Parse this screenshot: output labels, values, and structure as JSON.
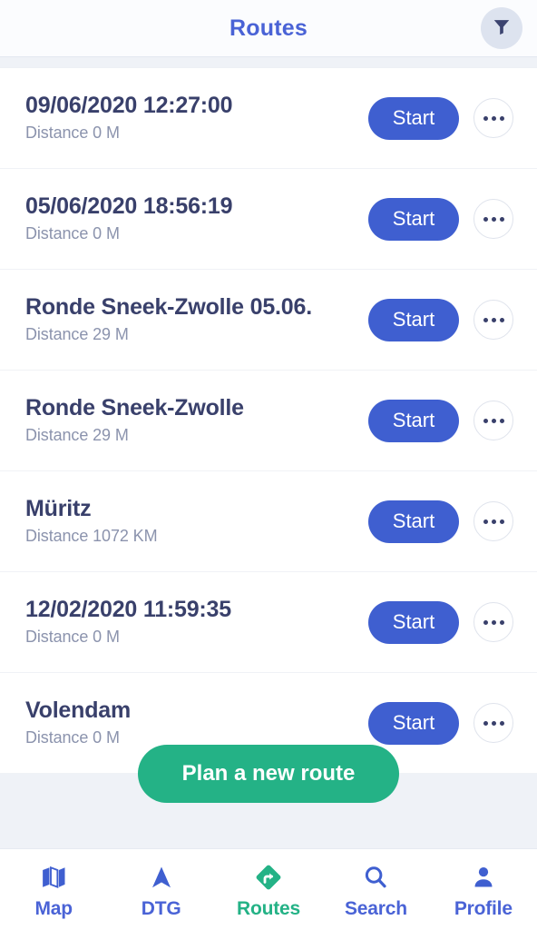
{
  "header": {
    "title": "Routes",
    "filter_icon": "filter-funnel-icon"
  },
  "routes": [
    {
      "title": "09/06/2020 12:27:00",
      "distance": "Distance 0 M",
      "start_label": "Start",
      "more_icon": "ellipsis-icon"
    },
    {
      "title": "05/06/2020 18:56:19",
      "distance": "Distance 0 M",
      "start_label": "Start",
      "more_icon": "ellipsis-icon"
    },
    {
      "title": "Ronde Sneek-Zwolle 05.06.",
      "distance": "Distance 29 M",
      "start_label": "Start",
      "more_icon": "ellipsis-icon"
    },
    {
      "title": "Ronde Sneek-Zwolle",
      "distance": "Distance 29 M",
      "start_label": "Start",
      "more_icon": "ellipsis-icon"
    },
    {
      "title": "Müritz",
      "distance": "Distance 1072 KM",
      "start_label": "Start",
      "more_icon": "ellipsis-icon"
    },
    {
      "title": "12/02/2020 11:59:35",
      "distance": "Distance 0 M",
      "start_label": "Start",
      "more_icon": "ellipsis-icon"
    },
    {
      "title": "Volendam",
      "distance": "Distance 0 M",
      "start_label": "Start",
      "more_icon": "ellipsis-icon"
    }
  ],
  "cta": {
    "label": "Plan a new route"
  },
  "bottom_nav": {
    "items": [
      {
        "label": "Map",
        "icon": "map-icon",
        "active": false
      },
      {
        "label": "DTG",
        "icon": "navigation-arrow-icon",
        "active": false
      },
      {
        "label": "Routes",
        "icon": "route-turn-icon",
        "active": true
      },
      {
        "label": "Search",
        "icon": "search-icon",
        "active": false
      },
      {
        "label": "Profile",
        "icon": "person-icon",
        "active": false
      }
    ]
  },
  "colors": {
    "accent_blue": "#4a63d6",
    "button_blue": "#3f5fd0",
    "accent_green": "#24b286",
    "title_navy": "#39406b",
    "muted_grey": "#8b93ad",
    "panel_grey": "#eff2f7"
  }
}
